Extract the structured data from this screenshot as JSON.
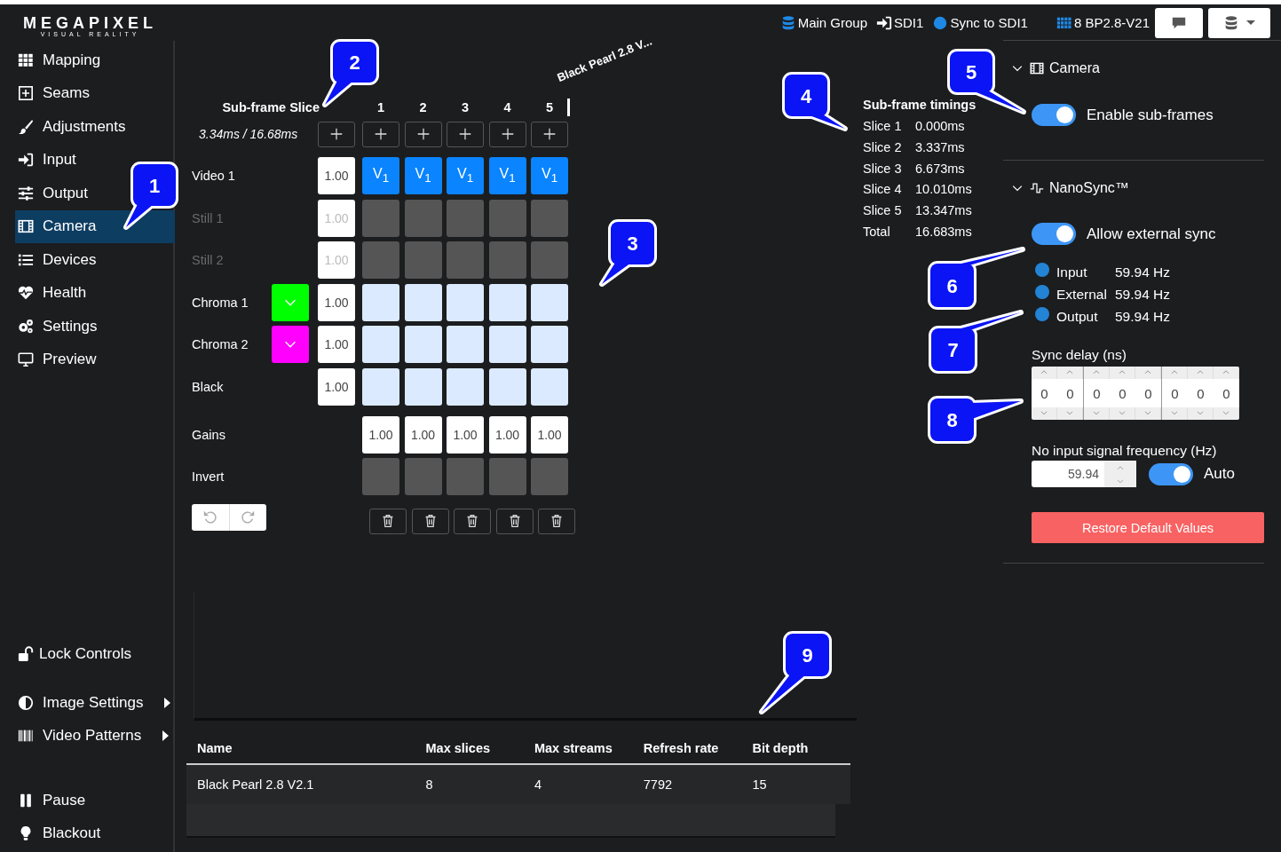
{
  "brand": {
    "name": "MEGAPIXEL",
    "tagline": "VISUAL REALITY"
  },
  "top_bar": {
    "items": [
      {
        "kind": "group",
        "label": "Main Group"
      },
      {
        "kind": "input",
        "label": "SDI1"
      },
      {
        "kind": "sync",
        "label": "Sync to SDI1"
      },
      {
        "kind": "processor",
        "label": "8 BP2.8-V21"
      }
    ]
  },
  "sidebar": {
    "items": [
      {
        "label": "Mapping",
        "selected": false
      },
      {
        "label": "Seams",
        "selected": false
      },
      {
        "label": "Adjustments",
        "selected": false
      },
      {
        "label": "Input",
        "selected": false
      },
      {
        "label": "Output",
        "selected": false
      },
      {
        "label": "Camera",
        "selected": true
      },
      {
        "label": "Devices",
        "selected": false
      },
      {
        "label": "Health",
        "selected": false
      },
      {
        "label": "Settings",
        "selected": false
      },
      {
        "label": "Preview",
        "selected": false
      }
    ],
    "bottom_items": [
      {
        "label": "Lock Controls",
        "submenu": false
      },
      {
        "label": "Image Settings",
        "submenu": true
      },
      {
        "label": "Video Patterns",
        "submenu": true
      },
      {
        "label": "Pause",
        "submenu": false
      },
      {
        "label": "Blackout",
        "submenu": false
      }
    ]
  },
  "matrix": {
    "title": "Sub-frame Slice",
    "columns": [
      "1",
      "2",
      "3",
      "4",
      "5"
    ],
    "device_label": "Black Pearl 2.8 V...",
    "timing": "3.34ms / 16.68ms",
    "rows": [
      {
        "label": "Video 1",
        "disabled": false,
        "gain": "1.00",
        "cells": [
          {
            "kind": "source",
            "label": "V$_{1}$"
          },
          {
            "kind": "source",
            "label": "V$_{1}$"
          },
          {
            "kind": "source",
            "label": "V$_{1}$"
          },
          {
            "kind": "source",
            "label": "V$_{1}$"
          },
          {
            "kind": "source",
            "label": "V$_{1}$"
          }
        ]
      },
      {
        "label": "Still 1",
        "disabled": true,
        "gain": "1.00",
        "cells": [
          {
            "kind": "empty"
          },
          {
            "kind": "empty"
          },
          {
            "kind": "empty"
          },
          {
            "kind": "empty"
          },
          {
            "kind": "empty"
          }
        ]
      },
      {
        "label": "Still 2",
        "disabled": true,
        "gain": "1.00",
        "cells": [
          {
            "kind": "empty"
          },
          {
            "kind": "empty"
          },
          {
            "kind": "empty"
          },
          {
            "kind": "empty"
          },
          {
            "kind": "empty"
          }
        ]
      },
      {
        "label": "Chroma 1",
        "disabled": false,
        "color": "#00ff00",
        "gain": "1.00",
        "cells": [
          {
            "kind": "key"
          },
          {
            "kind": "key"
          },
          {
            "kind": "key"
          },
          {
            "kind": "key"
          },
          {
            "kind": "key"
          }
        ]
      },
      {
        "label": "Chroma 2",
        "disabled": false,
        "color": "#ff00ff",
        "gain": "1.00",
        "cells": [
          {
            "kind": "key"
          },
          {
            "kind": "key"
          },
          {
            "kind": "key"
          },
          {
            "kind": "key"
          },
          {
            "kind": "key"
          }
        ]
      },
      {
        "label": "Black",
        "disabled": false,
        "gain": "1.00",
        "cells": [
          {
            "kind": "key"
          },
          {
            "kind": "key"
          },
          {
            "kind": "key"
          },
          {
            "kind": "key"
          },
          {
            "kind": "key"
          }
        ]
      }
    ],
    "gains_label": "Gains",
    "gains": [
      "1.00",
      "1.00",
      "1.00",
      "1.00",
      "1.00"
    ],
    "invert_label": "Invert",
    "invert": [
      {
        "checked": false
      },
      {
        "checked": false
      },
      {
        "checked": false
      },
      {
        "checked": false
      },
      {
        "checked": false
      }
    ]
  },
  "timings": {
    "title": "Sub-frame timings",
    "rows": [
      {
        "label": "Slice 1",
        "value": "0.000ms"
      },
      {
        "label": "Slice 2",
        "value": "3.337ms"
      },
      {
        "label": "Slice 3",
        "value": "6.673ms"
      },
      {
        "label": "Slice 4",
        "value": "10.010ms"
      },
      {
        "label": "Slice 5",
        "value": "13.347ms"
      },
      {
        "label": "Total",
        "value": "16.683ms"
      }
    ]
  },
  "devices_table": {
    "columns": [
      "Name",
      "Max slices",
      "Max streams",
      "Refresh rate",
      "Bit depth"
    ],
    "rows": [
      [
        "Black Pearl 2.8 V2.1",
        "8",
        "4",
        "7792",
        "15"
      ]
    ]
  },
  "settings": {
    "camera": {
      "title": "Camera",
      "expanded": true,
      "enable_subframes": {
        "label": "Enable sub-frames",
        "on": true
      }
    },
    "nanosync": {
      "title": "NanoSync™",
      "expanded": true,
      "allow_external_sync": {
        "label": "Allow external sync",
        "on": true
      },
      "signals": [
        {
          "label": "Input",
          "value": "59.94 Hz",
          "color": "#2384d6"
        },
        {
          "label": "External",
          "value": "59.94 Hz",
          "color": "#2384d6"
        },
        {
          "label": "Output",
          "value": "59.94 Hz",
          "color": "#2384d6"
        }
      ],
      "sync_delay": {
        "label": "Sync delay (ns)",
        "groups": [
          [
            "0",
            "0"
          ],
          [
            "0",
            "0",
            "0"
          ],
          [
            "0",
            "0",
            "0"
          ]
        ]
      },
      "no_input_frequency": {
        "label": "No input signal frequency (Hz)",
        "value": "59.94",
        "auto": {
          "label": "Auto",
          "on": true
        }
      },
      "restore_button": "Restore Default Values"
    }
  },
  "callouts": [
    {
      "number": "1"
    },
    {
      "number": "2"
    },
    {
      "number": "3"
    },
    {
      "number": "4"
    },
    {
      "number": "5"
    },
    {
      "number": "6"
    },
    {
      "number": "7"
    },
    {
      "number": "8"
    },
    {
      "number": "9"
    }
  ]
}
